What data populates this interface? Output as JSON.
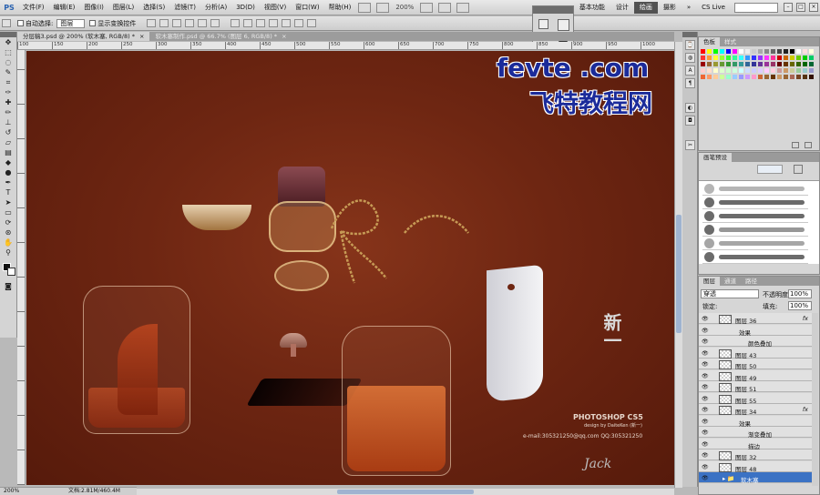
{
  "menubar": {
    "logo": "PS",
    "items": [
      "文件(F)",
      "编辑(E)",
      "图像(I)",
      "图层(L)",
      "选择(S)",
      "滤镜(T)",
      "分析(A)",
      "3D(D)",
      "视图(V)",
      "窗口(W)",
      "帮助(H)"
    ],
    "zoom": "200%",
    "workspaces": [
      "基本功能",
      "设计",
      "绘画",
      "摄影"
    ],
    "active_workspace": "绘画",
    "cs_live": "CS Live"
  },
  "optionsbar": {
    "auto_select_label": "自动选择:",
    "auto_select_value": "图层",
    "show_transform_label": "显示变换控件"
  },
  "doc_tabs": [
    {
      "label": "分层稿3.psd @ 200% (软木塞, RGB/8) *",
      "active": true
    },
    {
      "label": "软木塞制作.psd @ 66.7% (图层 6, RGB/8) *",
      "active": false
    }
  ],
  "ruler_ticks": [
    "100",
    "150",
    "200",
    "250",
    "300",
    "350",
    "400",
    "450",
    "500",
    "550",
    "600",
    "650",
    "700",
    "750",
    "800",
    "850",
    "900",
    "950",
    "1000",
    "1050"
  ],
  "status": {
    "zoom": "200%",
    "doc": "文档:2.81M/460.4M"
  },
  "watermark": {
    "line1": "fevte .com",
    "line2": "飞特教程网"
  },
  "canvas_text": {
    "chinese": "新一",
    "title": "PHOTOSHOP CS5",
    "design": "design by DaiteKen (新一)",
    "email": "e-mail:305321250@qq.com QQ:305321250",
    "signature": "Jack"
  },
  "panels": {
    "swatch_tabs": [
      "色板",
      "样式"
    ],
    "brush_tabs": [
      "画笔预设"
    ],
    "layers_tabs": [
      "图层",
      "通道",
      "路径"
    ],
    "blend_mode": "穿透",
    "opacity_label": "不透明度:",
    "opacity_value": "100%",
    "lock_label": "锁定:",
    "fill_label": "填充:",
    "fill_value": "100%"
  },
  "layers": [
    {
      "name": "图层 36",
      "fx": true,
      "kind": "layer"
    },
    {
      "name": "效果",
      "kind": "effects"
    },
    {
      "name": "颜色叠加",
      "kind": "effect"
    },
    {
      "name": "图层 43",
      "kind": "layer"
    },
    {
      "name": "图层 50",
      "kind": "layer"
    },
    {
      "name": "图层 49",
      "kind": "layer"
    },
    {
      "name": "图层 51",
      "kind": "layer"
    },
    {
      "name": "图层 55",
      "kind": "layer"
    },
    {
      "name": "图层 34",
      "fx": true,
      "kind": "layer"
    },
    {
      "name": "效果",
      "kind": "effects"
    },
    {
      "name": "渐变叠加",
      "kind": "effect"
    },
    {
      "name": "描边",
      "kind": "effect"
    },
    {
      "name": "图层 32",
      "kind": "layer"
    },
    {
      "name": "图层 48",
      "kind": "layer"
    },
    {
      "name": "软木塞",
      "kind": "group",
      "selected": true
    }
  ],
  "colors": {
    "canvas": "#6e2612",
    "selected_layer": "#3b72c4",
    "watermark": "#1b2b9a"
  }
}
